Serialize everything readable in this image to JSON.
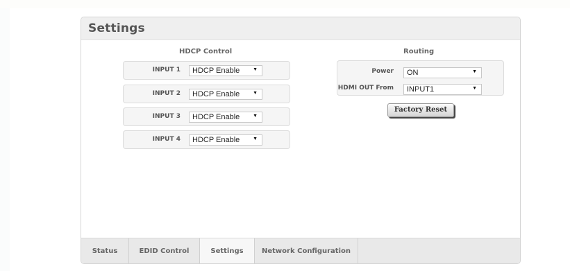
{
  "panel": {
    "title": "Settings"
  },
  "hdcp": {
    "title": "HDCP Control",
    "rows": [
      {
        "label": "INPUT 1",
        "value": "HDCP Enable"
      },
      {
        "label": "INPUT 2",
        "value": "HDCP Enable"
      },
      {
        "label": "INPUT 3",
        "value": "HDCP Enable"
      },
      {
        "label": "INPUT 4",
        "value": "HDCP Enable"
      }
    ]
  },
  "routing": {
    "title": "Routing",
    "power_label": "Power",
    "power_value": "ON",
    "hdmi_label": "HDMI OUT From",
    "hdmi_value": "INPUT1",
    "factory_reset": "Factory Reset"
  },
  "tabs": [
    {
      "label": "Status"
    },
    {
      "label": "EDID Control"
    },
    {
      "label": "Settings",
      "active": true
    },
    {
      "label": "Network Configuration"
    }
  ],
  "icons": {
    "dropdown": "dropdown-arrow-icon"
  }
}
